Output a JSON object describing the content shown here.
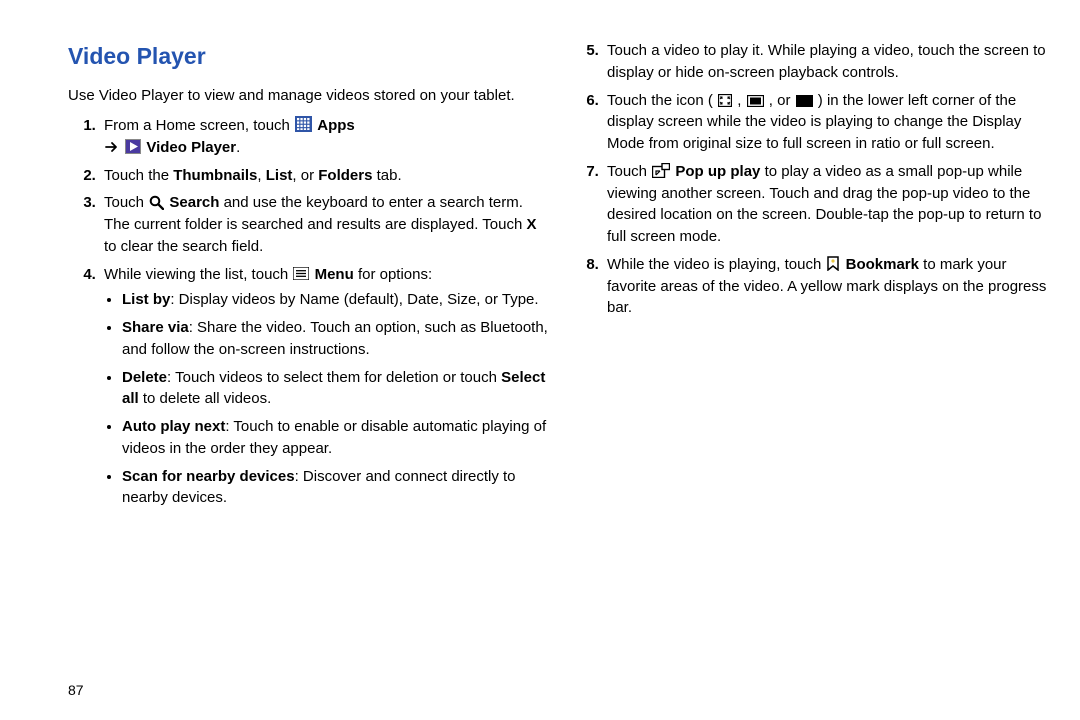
{
  "page_number": "87",
  "title": "Video Player",
  "intro": "Use Video Player to view and manage videos stored on your tablet.",
  "left": {
    "s1a": "From a Home screen, touch ",
    "s1_apps": "Apps",
    "s1b_arrow_prefix": " ",
    "s1_vp": "Video Player",
    "s1c": ".",
    "s2a": "Touch the ",
    "s2_thumb": "Thumbnails",
    "s2b": ", ",
    "s2_list": "List",
    "s2c": ", or ",
    "s2_folders": "Folders",
    "s2d": " tab.",
    "s3a": "Touch ",
    "s3_search": "Search",
    "s3b": " and use the keyboard to enter a search term. The current folder is searched and results are displayed. Touch ",
    "s3_x": "X",
    "s3c": " to clear the search field.",
    "s4a": "While viewing the list, touch ",
    "s4_menu": "Menu",
    "s4b": " for options:",
    "b1_label": "List by",
    "b1_text": ": Display videos by Name (default), Date, Size, or Type.",
    "b2_label": "Share via",
    "b2_text": ": Share the video. Touch an option, such as Bluetooth, and follow the on-screen instructions.",
    "b3_label": "Delete",
    "b3_text": ": Touch videos to select them for deletion or touch ",
    "b3_selectall": "Select all",
    "b3_text2": " to delete all videos.",
    "b4_label": "Auto play next",
    "b4_text": ": Touch to enable or disable automatic playing of videos in the order they appear.",
    "b5_label": "Scan for nearby devices",
    "b5_text": ": Discover and connect directly to nearby devices."
  },
  "right": {
    "s5": "Touch a video to play it. While playing a video, touch the screen to display or hide on-screen playback controls.",
    "s6a": "Touch the icon (",
    "s6b": ", ",
    "s6c": ", or ",
    "s6d": ") in the lower left corner of the display screen while the video is playing to change the Display Mode from original size to full screen in ratio or full screen.",
    "s7a": "Touch ",
    "s7_popup": "Pop up play",
    "s7b": " to play a video as a small pop-up while viewing another screen. Touch and drag the pop-up video to the desired location on the screen. Double-tap the pop-up to return to full screen mode.",
    "s8a": "While the video is playing, touch ",
    "s8_bookmark": "Bookmark",
    "s8b": " to mark your favorite areas of the video. A yellow mark displays on the progress bar."
  }
}
